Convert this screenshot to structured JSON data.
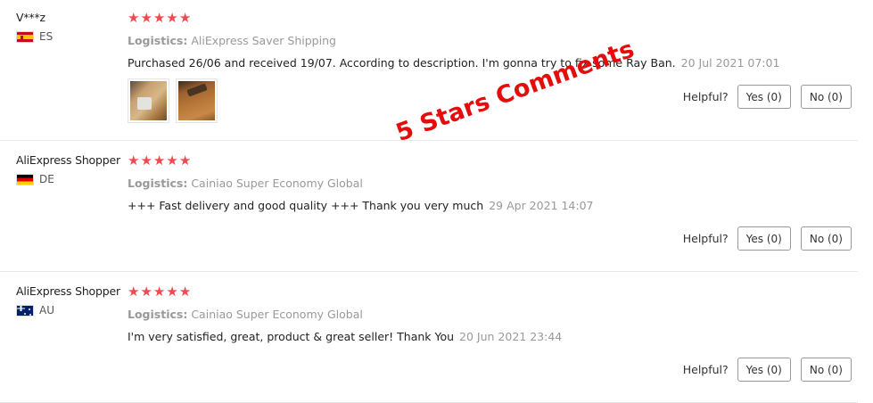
{
  "reviews": [
    {
      "username": "V***z",
      "country_code": "ES",
      "flag": "spain-flag-icon",
      "stars": 5,
      "logistics_label": "Logistics:",
      "logistics_value": "AliExpress Saver Shipping",
      "comment": "Purchased 26/06 and received 19/07. According to description. I'm gonna try to fix some Ray Ban.",
      "date": "20 Jul 2021 07:01",
      "helpful_label": "Helpful?",
      "yes_label": "Yes (0)",
      "no_label": "No (0)",
      "photo_count": 2
    },
    {
      "username": "AliExpress Shopper",
      "country_code": "DE",
      "flag": "germany-flag-icon",
      "stars": 5,
      "logistics_label": "Logistics:",
      "logistics_value": "Cainiao Super Economy Global",
      "comment": "+++ Fast delivery and good quality +++ Thank you very much",
      "date": "29 Apr 2021 14:07",
      "helpful_label": "Helpful?",
      "yes_label": "Yes (0)",
      "no_label": "No (0)"
    },
    {
      "username": "AliExpress Shopper",
      "country_code": "AU",
      "flag": "australia-flag-icon",
      "stars": 5,
      "logistics_label": "Logistics:",
      "logistics_value": "Cainiao Super Economy Global",
      "comment": "I'm very satisfied, great, product & great seller! Thank You",
      "date": "20 Jun 2021 23:44",
      "helpful_label": "Helpful?",
      "yes_label": "Yes (0)",
      "no_label": "No (0)"
    }
  ],
  "overlay": {
    "text": "5 Stars Comments",
    "color": "#e40c0c"
  },
  "colors": {
    "star": "#f04a4f",
    "muted_text": "#999999"
  }
}
